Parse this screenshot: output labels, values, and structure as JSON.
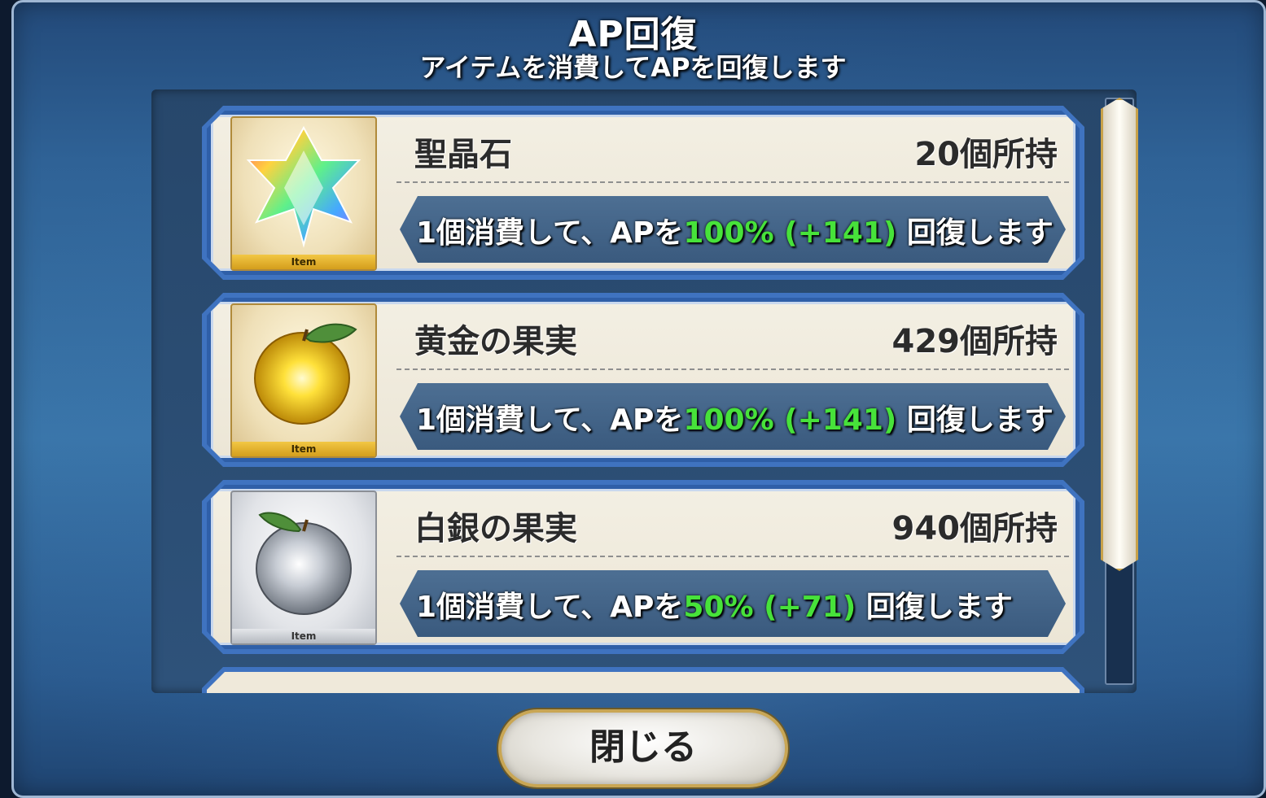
{
  "header": {
    "title": "AP回復",
    "subtitle": "アイテムを消費してAPを回復します"
  },
  "items": [
    {
      "name": "聖晶石",
      "count": "20個所持",
      "tag": "Item",
      "effect_prefix": "1個消費して、APを",
      "effect_value": "100% (+141)",
      "effect_suffix": " 回復します",
      "icon": "saint-quartz-icon"
    },
    {
      "name": "黄金の果実",
      "count": "429個所持",
      "tag": "Item",
      "effect_prefix": "1個消費して、APを",
      "effect_value": "100% (+141)",
      "effect_suffix": " 回復します",
      "icon": "golden-apple-icon"
    },
    {
      "name": "白銀の果実",
      "count": "940個所持",
      "tag": "Item",
      "effect_prefix": "1個消費して、APを",
      "effect_value": "50% (+71)",
      "effect_suffix": " 回復します",
      "icon": "silver-apple-icon"
    }
  ],
  "footer": {
    "close_label": "閉じる"
  },
  "colors": {
    "highlight_green": "#47e23a",
    "row_border": "#3f73c0",
    "dialog_bg": "#2f6296"
  }
}
